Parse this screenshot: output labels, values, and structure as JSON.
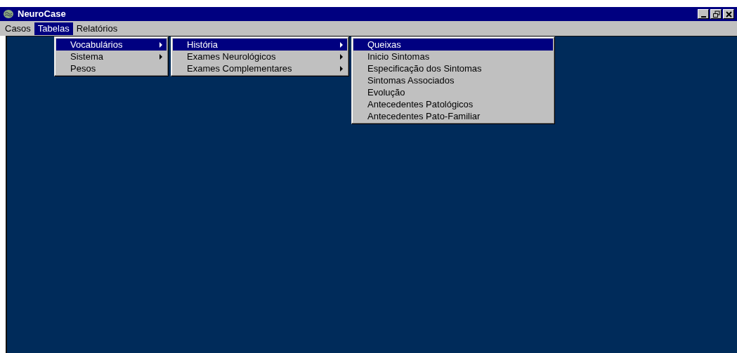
{
  "window": {
    "title": "NeuroCase"
  },
  "menu_bar": [
    {
      "label": "Casos",
      "selected": false
    },
    {
      "label": "Tabelas",
      "selected": true
    },
    {
      "label": "Relatórios",
      "selected": false
    }
  ],
  "menus": [
    {
      "items": [
        {
          "label": "Vocabulários",
          "selected": true,
          "submenu": true
        },
        {
          "label": "Sistema",
          "selected": false,
          "submenu": true
        },
        {
          "label": "Pesos",
          "selected": false,
          "submenu": false
        }
      ]
    },
    {
      "items": [
        {
          "label": "História",
          "selected": true,
          "submenu": true
        },
        {
          "label": "Exames Neurológicos",
          "selected": false,
          "submenu": true
        },
        {
          "label": "Exames Complementares",
          "selected": false,
          "submenu": true
        }
      ]
    },
    {
      "items": [
        {
          "label": "Queixas",
          "selected": true,
          "submenu": false
        },
        {
          "label": "Inicio Sintomas",
          "selected": false,
          "submenu": false
        },
        {
          "label": "Especificação dos Sintomas",
          "selected": false,
          "submenu": false
        },
        {
          "label": "Sintomas Associados",
          "selected": false,
          "submenu": false
        },
        {
          "label": "Evolução",
          "selected": false,
          "submenu": false
        },
        {
          "label": "Antecedentes Patológicos",
          "selected": false,
          "submenu": false
        },
        {
          "label": "Antecedentes Pato-Familiar",
          "selected": false,
          "submenu": false
        }
      ]
    }
  ]
}
